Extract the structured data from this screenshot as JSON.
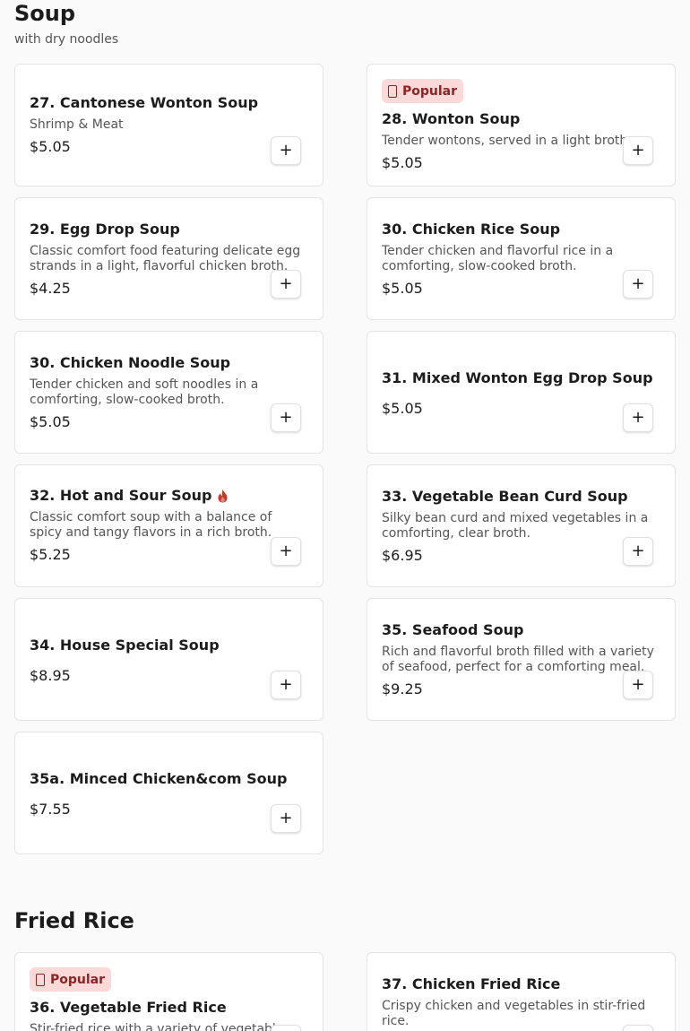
{
  "sections": {
    "soup": {
      "title": "Soup",
      "subtitle": "with dry noodles",
      "items": [
        {
          "name": "27. Cantonese Wonton Soup",
          "desc": "Shrimp & Meat",
          "price": "$5.05"
        },
        {
          "badge": "Popular",
          "name": "28. Wonton Soup",
          "desc": "Tender wontons, served in a light broth.",
          "price": "$5.05"
        },
        {
          "name": "29. Egg Drop Soup",
          "desc": "Classic comfort food featuring delicate egg strands in a light, flavorful chicken broth.",
          "price": "$4.25"
        },
        {
          "name": "30. Chicken Rice Soup",
          "desc": "Tender chicken and flavorful rice in a comforting, slow-cooked broth.",
          "price": "$5.05"
        },
        {
          "name": "30. Chicken Noodle Soup",
          "desc": "Tender chicken and soft noodles in a comforting, slow-cooked broth.",
          "price": "$5.05"
        },
        {
          "name": "31. Mixed Wonton Egg Drop Soup",
          "price": "$5.05"
        },
        {
          "name": "32. Hot and Sour Soup",
          "spicy": true,
          "desc": "Classic comfort soup with a balance of spicy and tangy flavors in a rich broth.",
          "price": "$5.25"
        },
        {
          "name": "33. Vegetable Bean Curd Soup",
          "desc": "Silky bean curd and mixed vegetables in a comforting, clear broth.",
          "price": "$6.95"
        },
        {
          "name": "34. House Special Soup",
          "price": "$8.95"
        },
        {
          "name": "35. Seafood Soup",
          "desc": "Rich and flavorful broth filled with a variety of seafood, perfect for a comforting meal.",
          "price": "$9.25"
        },
        {
          "name": "35a. Minced Chicken&com Soup",
          "price": "$7.55"
        }
      ]
    },
    "fried_rice": {
      "title": "Fried Rice",
      "items": [
        {
          "badge": "Popular",
          "name": "36. Vegetable Fried Rice",
          "desc": "Stir-fried rice with a variety of vegetables."
        },
        {
          "name": "37. Chicken Fried Rice",
          "desc": "Crispy chicken and vegetables in stir-fried rice."
        }
      ]
    }
  },
  "add_label": "+",
  "colors": {
    "badge_bg": "#fbd9d9",
    "badge_text": "#8f2323",
    "spicy": "#c0392b"
  }
}
